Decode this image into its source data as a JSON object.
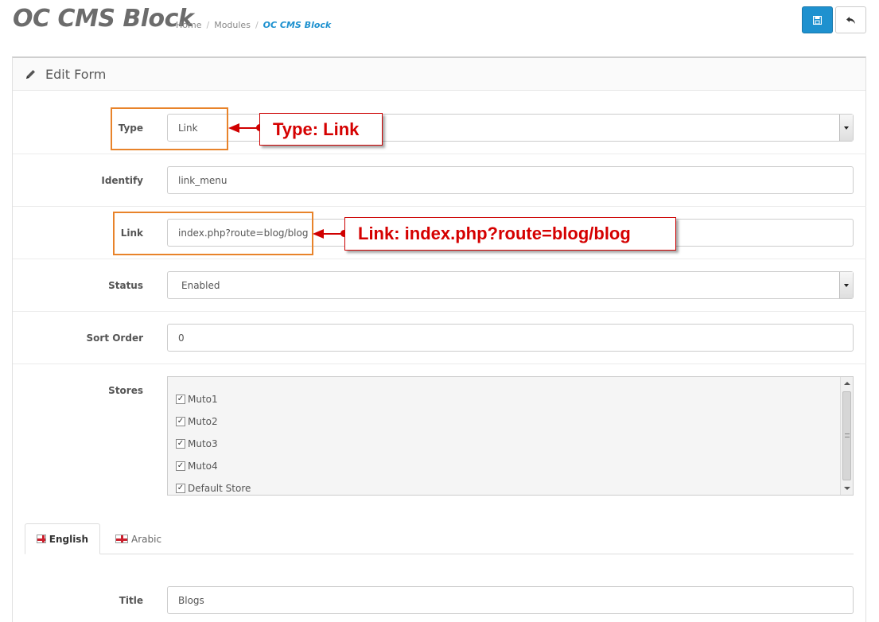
{
  "header": {
    "title": "OC CMS Block",
    "breadcrumb": [
      "Home",
      "Modules",
      "OC CMS Block"
    ],
    "save_icon": "save-icon",
    "back_icon": "reply-icon"
  },
  "panel": {
    "heading": "Edit Form",
    "heading_icon": "pencil-icon"
  },
  "form": {
    "type": {
      "label": "Type",
      "value": "Link"
    },
    "identify": {
      "label": "Identify",
      "value": "link_menu"
    },
    "link": {
      "label": "Link",
      "value": "index.php?route=blog/blog"
    },
    "status": {
      "label": "Status",
      "value": "Enabled"
    },
    "sort_order": {
      "label": "Sort Order",
      "value": "0"
    },
    "stores": {
      "label": "Stores",
      "items": [
        {
          "name": "Muto1",
          "checked": true
        },
        {
          "name": "Muto2",
          "checked": true
        },
        {
          "name": "Muto3",
          "checked": true
        },
        {
          "name": "Muto4",
          "checked": true
        },
        {
          "name": "Default Store",
          "checked": true
        }
      ]
    },
    "title": {
      "label": "Title",
      "value": "Blogs"
    }
  },
  "tabs": [
    {
      "label": "English",
      "active": true
    },
    {
      "label": "Arabic",
      "active": false
    }
  ],
  "annotations": {
    "type_callout": "Type: Link",
    "link_callout": "Link: index.php?route=blog/blog",
    "highlight_color": "#e8832a",
    "callout_color": "#d50000"
  },
  "colors": {
    "primary": "#1e91cf",
    "breadcrumb_active": "#1e91cf"
  }
}
